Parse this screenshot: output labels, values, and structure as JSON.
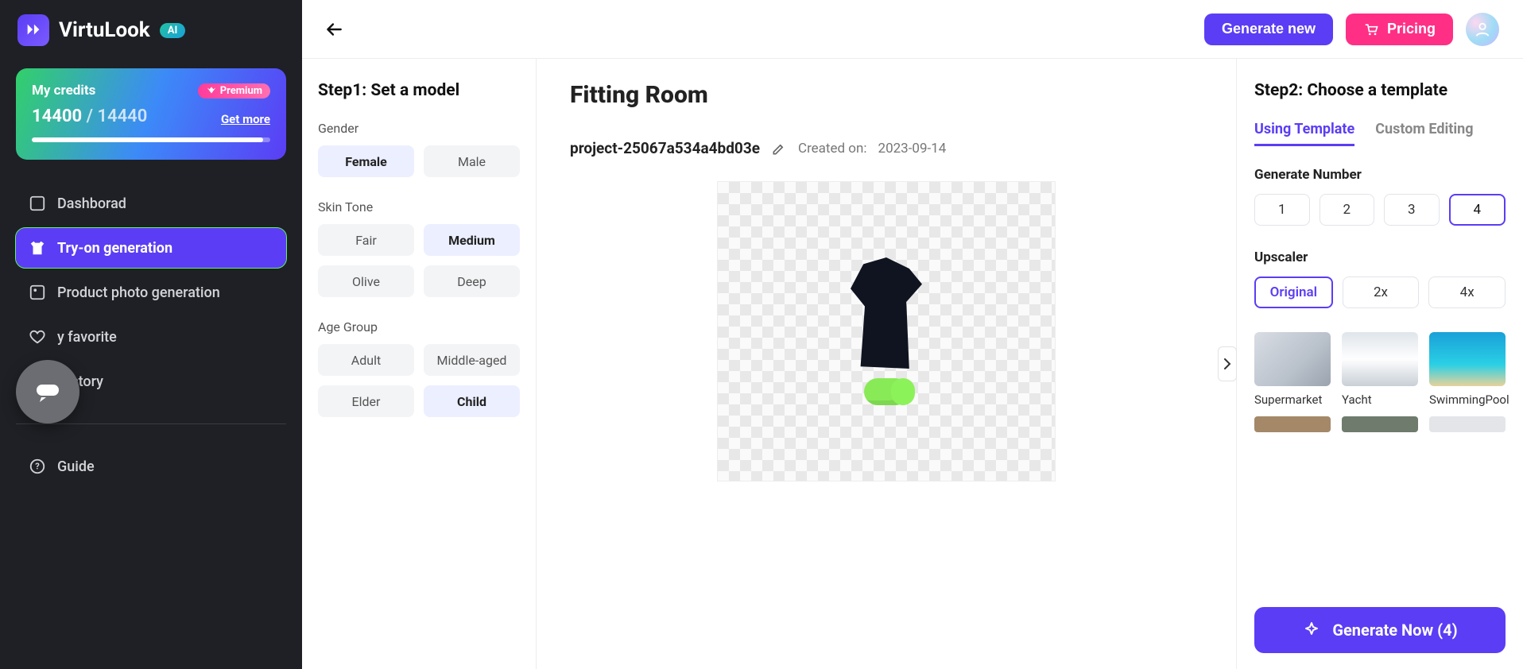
{
  "brand": {
    "name": "VirtuLook",
    "ai_pill": "AI"
  },
  "credits": {
    "label": "My credits",
    "premium": "Premium",
    "current": "14400",
    "sep": " / ",
    "total": "14440",
    "get_more": "Get more"
  },
  "nav": {
    "dashboard": "Dashborad",
    "tryon": "Try-on generation",
    "product": "Product photo generation",
    "favorite": "y favorite",
    "history": "History",
    "guide": "Guide"
  },
  "topbar": {
    "generate_new": "Generate new",
    "pricing": "Pricing"
  },
  "step1": {
    "title": "Step1: Set a model",
    "gender_label": "Gender",
    "gender": {
      "female": "Female",
      "male": "Male"
    },
    "skin_label": "Skin Tone",
    "skin": {
      "fair": "Fair",
      "medium": "Medium",
      "olive": "Olive",
      "deep": "Deep"
    },
    "age_label": "Age Group",
    "age": {
      "adult": "Adult",
      "middle": "Middle-aged",
      "elder": "Elder",
      "child": "Child"
    }
  },
  "center": {
    "title": "Fitting Room",
    "project": "project-25067a534a4bd03e",
    "created_label": "Created on:",
    "created_date": "2023-09-14"
  },
  "step2": {
    "title": "Step2: Choose a template",
    "tab_using": "Using Template",
    "tab_custom": "Custom Editing",
    "gen_number_label": "Generate Number",
    "numbers": {
      "n1": "1",
      "n2": "2",
      "n3": "3",
      "n4": "4"
    },
    "upscaler_label": "Upscaler",
    "upscaler": {
      "original": "Original",
      "x2": "2x",
      "x4": "4x"
    },
    "templates": {
      "supermarket": "Supermarket",
      "yacht": "Yacht",
      "pool": "SwimmingPool"
    },
    "generate_btn": "Generate Now (4)"
  }
}
